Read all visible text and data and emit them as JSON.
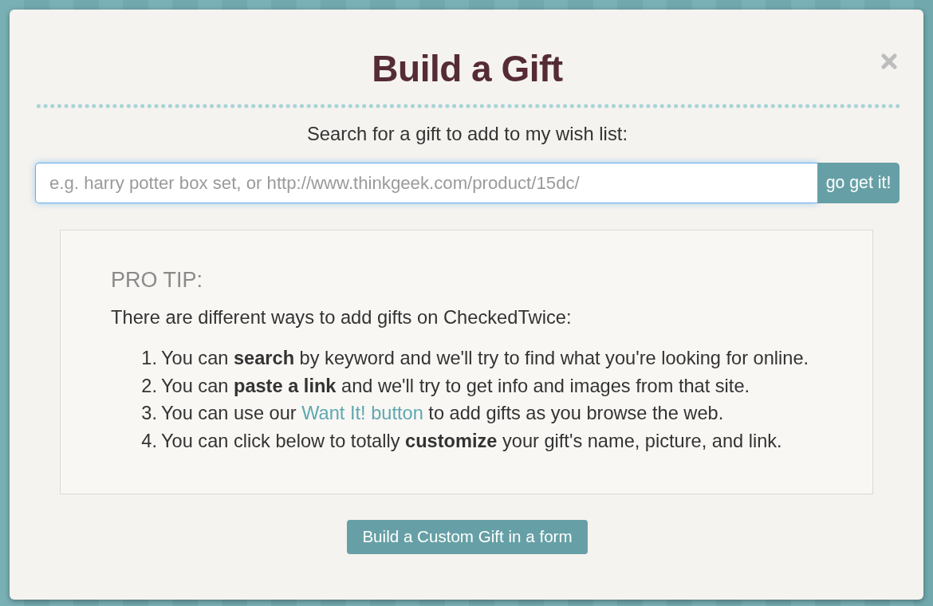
{
  "dialog": {
    "title": "Build a Gift",
    "search_label": "Search for a gift to add to my wish list:",
    "search": {
      "placeholder": "e.g. harry potter box set, or http://www.thinkgeek.com/product/15dc/",
      "focused": true,
      "button": "go get it!"
    },
    "pro_tip": {
      "heading": "PRO TIP:",
      "intro": "There are different ways to add gifts on CheckedTwice:",
      "steps": [
        {
          "number": "1.",
          "parts": [
            {
              "kind": "text",
              "text": "You can **search** by keyword and we'll try to find what you're looking for online."
            }
          ]
        },
        {
          "number": "2.",
          "parts": [
            {
              "kind": "text",
              "text": "You can **paste a link** and we'll try to get info and images from that site."
            }
          ]
        },
        {
          "number": "3.",
          "parts": [
            {
              "kind": "text",
              "text": "You can use our "
            },
            {
              "kind": "link",
              "text": "Want It! button"
            },
            {
              "kind": "text",
              "text": " to add gifts as you browse the web."
            }
          ]
        },
        {
          "number": "4.",
          "parts": [
            {
              "kind": "text",
              "text": "You can click below to totally **customize** your gift's name, picture, and link."
            }
          ]
        }
      ]
    },
    "custom_button": "Build a Custom Gift in a form"
  }
}
